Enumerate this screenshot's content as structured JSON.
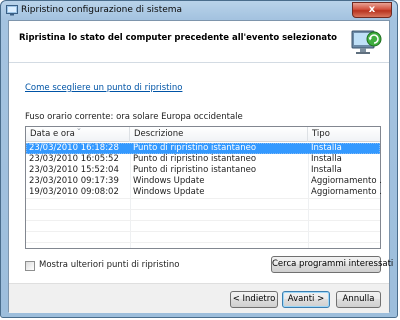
{
  "window": {
    "title": "Ripristino configurazione di sistema",
    "close_label": "x"
  },
  "header": {
    "title": "Ripristina lo stato del computer precedente all'evento selezionato"
  },
  "link": {
    "label": "Come scegliere un punto di ripristino"
  },
  "timezone": {
    "label": "Fuso orario corrente: ora solare Europa occidentale"
  },
  "table": {
    "columns": [
      "Data e ora",
      "Descrizione",
      "Tipo"
    ],
    "selected_index": 0,
    "rows": [
      {
        "date": "23/03/2010 16:18:28",
        "description": "Punto di ripristino istantaneo",
        "type": "Installa"
      },
      {
        "date": "23/03/2010 16:05:52",
        "description": "Punto di ripristino istantaneo",
        "type": "Installa"
      },
      {
        "date": "23/03/2010 15:52:04",
        "description": "Punto di ripristino istantaneo",
        "type": "Installa"
      },
      {
        "date": "23/03/2010 09:17:39",
        "description": "Windows Update",
        "type": "Aggiornamento ..."
      },
      {
        "date": "19/03/2010 09:08:02",
        "description": "Windows Update",
        "type": "Aggiornamento ..."
      }
    ]
  },
  "show_more": {
    "label": "Mostra ulteriori punti di ripristino",
    "checked": false
  },
  "buttons": {
    "scan": "Cerca programmi interessati",
    "back": "< Indietro",
    "next": "Avanti >",
    "cancel": "Annulla"
  },
  "colors": {
    "selection": "#3399ff",
    "link": "#0054a6",
    "frame": "#a4c3e0"
  }
}
